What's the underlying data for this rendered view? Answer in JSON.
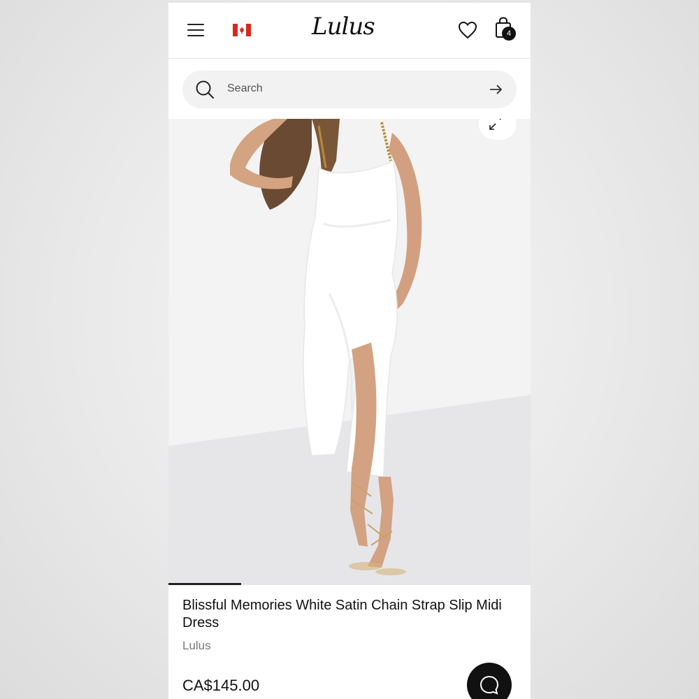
{
  "header": {
    "menu_icon": "hamburger-menu-icon",
    "region_icon": "canada-flag-icon",
    "logo": "Lulus",
    "wishlist_icon": "heart-icon",
    "cart_icon": "shopping-bag-icon",
    "cart_count": "4"
  },
  "search": {
    "icon": "search-icon",
    "placeholder": "Search",
    "submit_icon": "arrow-right-icon"
  },
  "gallery": {
    "expand_icon": "expand-arrows-icon",
    "progress": 0.2
  },
  "product": {
    "title": "Blissful Memories White Satin Chain Strap Slip Midi Dress",
    "brand": "Lulus",
    "price": "CA$145.00"
  },
  "chat": {
    "icon": "chat-bubble-icon"
  },
  "colors": {
    "accent": "#111111",
    "search_bg": "#f2f2f2",
    "flag_red": "#d52b1e"
  }
}
